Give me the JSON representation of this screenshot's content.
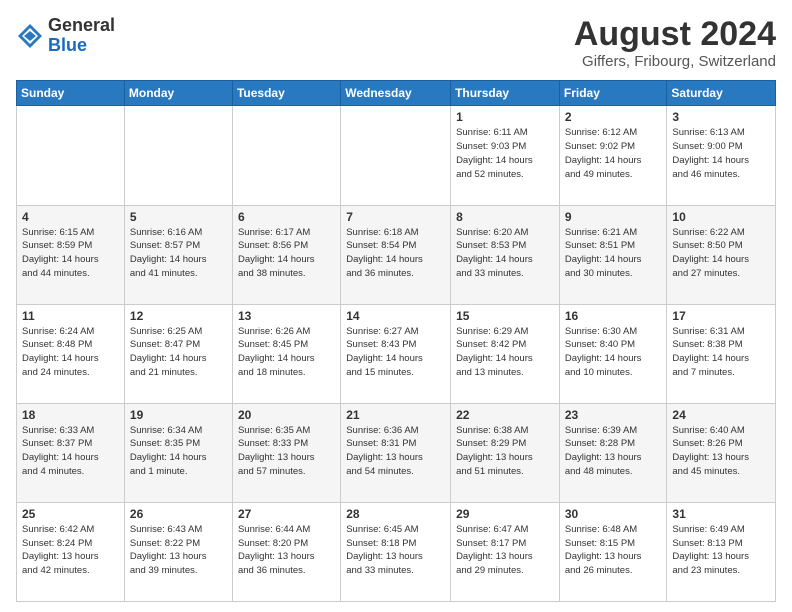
{
  "header": {
    "logo_general": "General",
    "logo_blue": "Blue",
    "month_title": "August 2024",
    "location": "Giffers, Fribourg, Switzerland"
  },
  "days_of_week": [
    "Sunday",
    "Monday",
    "Tuesday",
    "Wednesday",
    "Thursday",
    "Friday",
    "Saturday"
  ],
  "weeks": [
    [
      {
        "day": "",
        "info": ""
      },
      {
        "day": "",
        "info": ""
      },
      {
        "day": "",
        "info": ""
      },
      {
        "day": "",
        "info": ""
      },
      {
        "day": "1",
        "info": "Sunrise: 6:11 AM\nSunset: 9:03 PM\nDaylight: 14 hours\nand 52 minutes."
      },
      {
        "day": "2",
        "info": "Sunrise: 6:12 AM\nSunset: 9:02 PM\nDaylight: 14 hours\nand 49 minutes."
      },
      {
        "day": "3",
        "info": "Sunrise: 6:13 AM\nSunset: 9:00 PM\nDaylight: 14 hours\nand 46 minutes."
      }
    ],
    [
      {
        "day": "4",
        "info": "Sunrise: 6:15 AM\nSunset: 8:59 PM\nDaylight: 14 hours\nand 44 minutes."
      },
      {
        "day": "5",
        "info": "Sunrise: 6:16 AM\nSunset: 8:57 PM\nDaylight: 14 hours\nand 41 minutes."
      },
      {
        "day": "6",
        "info": "Sunrise: 6:17 AM\nSunset: 8:56 PM\nDaylight: 14 hours\nand 38 minutes."
      },
      {
        "day": "7",
        "info": "Sunrise: 6:18 AM\nSunset: 8:54 PM\nDaylight: 14 hours\nand 36 minutes."
      },
      {
        "day": "8",
        "info": "Sunrise: 6:20 AM\nSunset: 8:53 PM\nDaylight: 14 hours\nand 33 minutes."
      },
      {
        "day": "9",
        "info": "Sunrise: 6:21 AM\nSunset: 8:51 PM\nDaylight: 14 hours\nand 30 minutes."
      },
      {
        "day": "10",
        "info": "Sunrise: 6:22 AM\nSunset: 8:50 PM\nDaylight: 14 hours\nand 27 minutes."
      }
    ],
    [
      {
        "day": "11",
        "info": "Sunrise: 6:24 AM\nSunset: 8:48 PM\nDaylight: 14 hours\nand 24 minutes."
      },
      {
        "day": "12",
        "info": "Sunrise: 6:25 AM\nSunset: 8:47 PM\nDaylight: 14 hours\nand 21 minutes."
      },
      {
        "day": "13",
        "info": "Sunrise: 6:26 AM\nSunset: 8:45 PM\nDaylight: 14 hours\nand 18 minutes."
      },
      {
        "day": "14",
        "info": "Sunrise: 6:27 AM\nSunset: 8:43 PM\nDaylight: 14 hours\nand 15 minutes."
      },
      {
        "day": "15",
        "info": "Sunrise: 6:29 AM\nSunset: 8:42 PM\nDaylight: 14 hours\nand 13 minutes."
      },
      {
        "day": "16",
        "info": "Sunrise: 6:30 AM\nSunset: 8:40 PM\nDaylight: 14 hours\nand 10 minutes."
      },
      {
        "day": "17",
        "info": "Sunrise: 6:31 AM\nSunset: 8:38 PM\nDaylight: 14 hours\nand 7 minutes."
      }
    ],
    [
      {
        "day": "18",
        "info": "Sunrise: 6:33 AM\nSunset: 8:37 PM\nDaylight: 14 hours\nand 4 minutes."
      },
      {
        "day": "19",
        "info": "Sunrise: 6:34 AM\nSunset: 8:35 PM\nDaylight: 14 hours\nand 1 minute."
      },
      {
        "day": "20",
        "info": "Sunrise: 6:35 AM\nSunset: 8:33 PM\nDaylight: 13 hours\nand 57 minutes."
      },
      {
        "day": "21",
        "info": "Sunrise: 6:36 AM\nSunset: 8:31 PM\nDaylight: 13 hours\nand 54 minutes."
      },
      {
        "day": "22",
        "info": "Sunrise: 6:38 AM\nSunset: 8:29 PM\nDaylight: 13 hours\nand 51 minutes."
      },
      {
        "day": "23",
        "info": "Sunrise: 6:39 AM\nSunset: 8:28 PM\nDaylight: 13 hours\nand 48 minutes."
      },
      {
        "day": "24",
        "info": "Sunrise: 6:40 AM\nSunset: 8:26 PM\nDaylight: 13 hours\nand 45 minutes."
      }
    ],
    [
      {
        "day": "25",
        "info": "Sunrise: 6:42 AM\nSunset: 8:24 PM\nDaylight: 13 hours\nand 42 minutes."
      },
      {
        "day": "26",
        "info": "Sunrise: 6:43 AM\nSunset: 8:22 PM\nDaylight: 13 hours\nand 39 minutes."
      },
      {
        "day": "27",
        "info": "Sunrise: 6:44 AM\nSunset: 8:20 PM\nDaylight: 13 hours\nand 36 minutes."
      },
      {
        "day": "28",
        "info": "Sunrise: 6:45 AM\nSunset: 8:18 PM\nDaylight: 13 hours\nand 33 minutes."
      },
      {
        "day": "29",
        "info": "Sunrise: 6:47 AM\nSunset: 8:17 PM\nDaylight: 13 hours\nand 29 minutes."
      },
      {
        "day": "30",
        "info": "Sunrise: 6:48 AM\nSunset: 8:15 PM\nDaylight: 13 hours\nand 26 minutes."
      },
      {
        "day": "31",
        "info": "Sunrise: 6:49 AM\nSunset: 8:13 PM\nDaylight: 13 hours\nand 23 minutes."
      }
    ]
  ]
}
